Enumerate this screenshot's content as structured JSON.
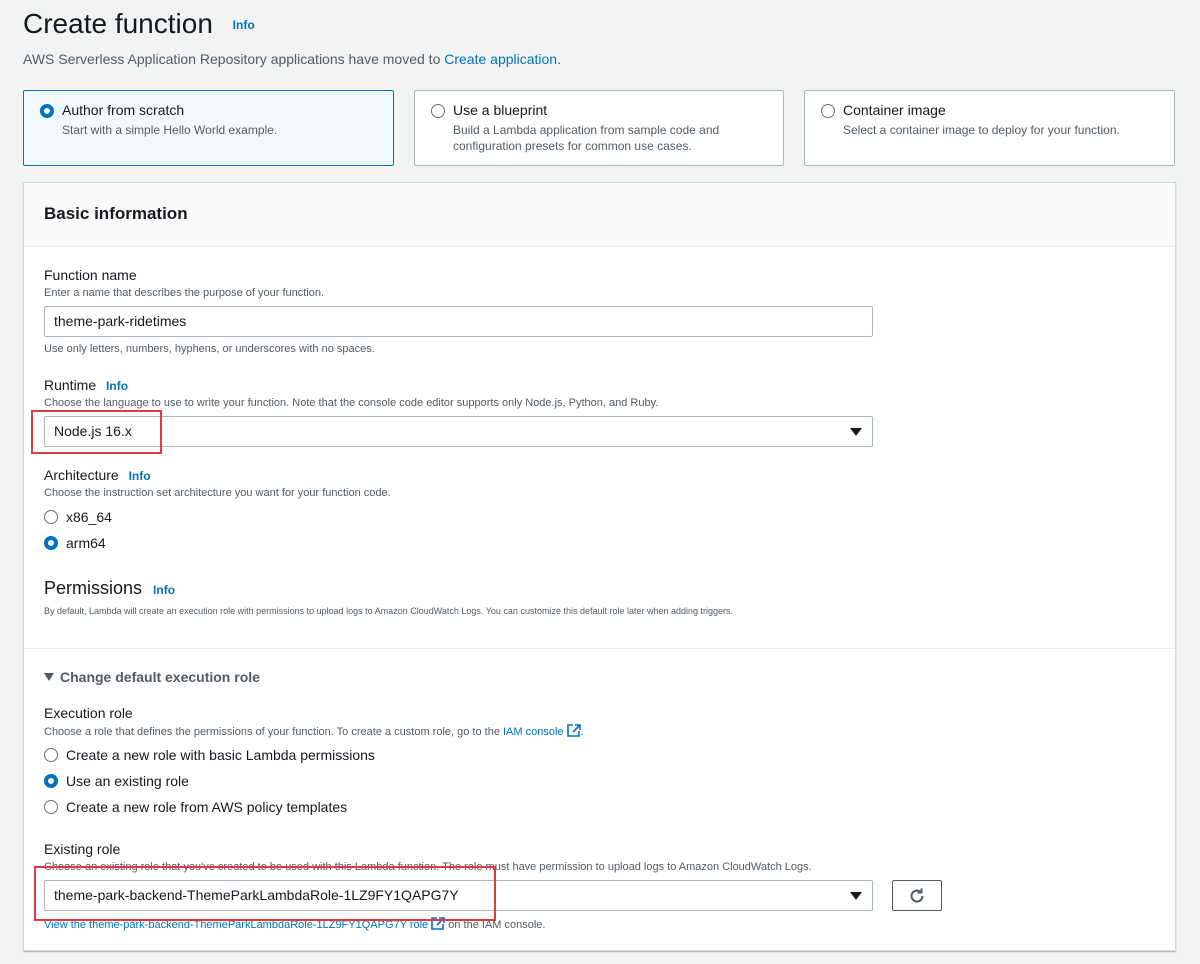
{
  "header": {
    "title": "Create function",
    "info": "Info",
    "subtitle_prefix": "AWS Serverless Application Repository applications have moved to ",
    "subtitle_link": "Create application",
    "subtitle_suffix": "."
  },
  "tiles": [
    {
      "title": "Author from scratch",
      "desc": "Start with a simple Hello World example.",
      "selected": true
    },
    {
      "title": "Use a blueprint",
      "desc": "Build a Lambda application from sample code and configuration presets for common use cases.",
      "selected": false
    },
    {
      "title": "Container image",
      "desc": "Select a container image to deploy for your function.",
      "selected": false
    }
  ],
  "basic": {
    "title": "Basic information",
    "function_name": {
      "label": "Function name",
      "desc": "Enter a name that describes the purpose of your function.",
      "value": "theme-park-ridetimes",
      "hint": "Use only letters, numbers, hyphens, or underscores with no spaces."
    },
    "runtime": {
      "label": "Runtime",
      "info": "Info",
      "desc": "Choose the language to use to write your function. Note that the console code editor supports only Node.js, Python, and Ruby.",
      "value": "Node.js 16.x"
    },
    "architecture": {
      "label": "Architecture",
      "info": "Info",
      "desc": "Choose the instruction set architecture you want for your function code.",
      "options": [
        "x86_64",
        "arm64"
      ],
      "selected": "arm64"
    },
    "permissions": {
      "title": "Permissions",
      "info": "Info",
      "desc": "By default, Lambda will create an execution role with permissions to upload logs to Amazon CloudWatch Logs. You can customize this default role later when adding triggers."
    },
    "exec_role_toggle": "Change default execution role",
    "execution_role": {
      "label": "Execution role",
      "desc_prefix": "Choose a role that defines the permissions of your function. To create a custom role, go to the ",
      "desc_link": "IAM console",
      "desc_suffix": ".",
      "options": [
        "Create a new role with basic Lambda permissions",
        "Use an existing role",
        "Create a new role from AWS policy templates"
      ],
      "selected": "Use an existing role"
    },
    "existing_role": {
      "label": "Existing role",
      "desc": "Choose an existing role that you've created to be used with this Lambda function. The role must have permission to upload logs to Amazon CloudWatch Logs.",
      "value": "theme-park-backend-ThemeParkLambdaRole-1LZ9FY1QAPG7Y",
      "view_link": "View the theme-park-backend-ThemeParkLambdaRole-1LZ9FY1QAPG7Y role",
      "view_suffix": " on the IAM console."
    }
  },
  "colors": {
    "accent": "#0073bb",
    "highlight": "#e0393e"
  }
}
